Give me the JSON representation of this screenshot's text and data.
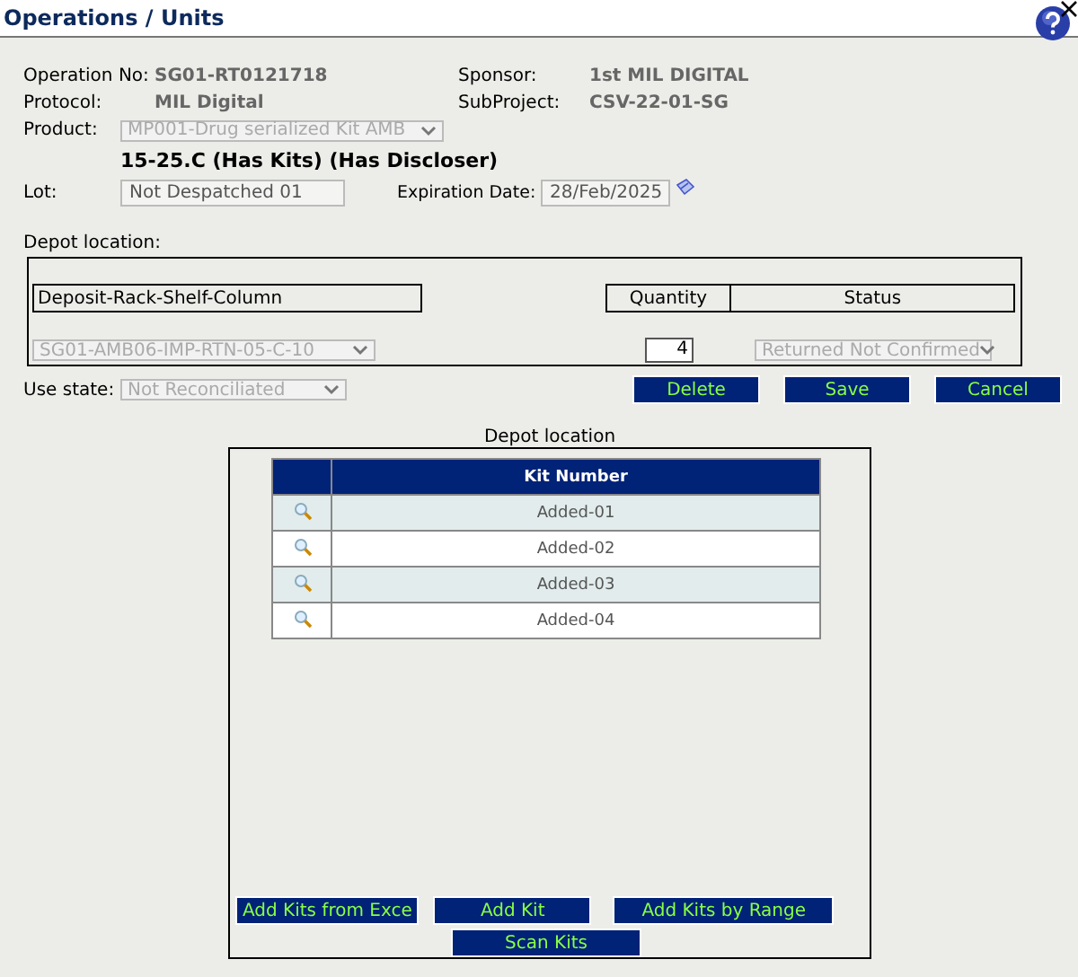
{
  "window": {
    "title": "Operations / Units"
  },
  "info": [
    {
      "label": "Operation No:",
      "value": "SG01-RT0121718"
    },
    {
      "label": "Sponsor:",
      "value": "1st MIL DIGITAL"
    },
    {
      "label": "Protocol:",
      "value": "MIL Digital"
    },
    {
      "label": "SubProject:",
      "value": "CSV-22-01-SG"
    }
  ],
  "product": {
    "label": "Product:",
    "value": "MP001-Drug serialized Kit AMB",
    "disabled": true
  },
  "product_tags": "15-25.C  (Has Kits)  (Has Discloser)",
  "lot": {
    "label": "Lot:",
    "value": "Not Despatched 01"
  },
  "expiration": {
    "label": "Expiration Date:",
    "value": "28/Feb/2025"
  },
  "depot": {
    "label": "Depot location:",
    "columns": [
      "Deposit-Rack-Shelf-Column",
      "Quantity",
      "Status"
    ],
    "location": {
      "value": "SG01-AMB06-IMP-RTN-05-C-10",
      "disabled": true
    },
    "quantity": "4",
    "status": {
      "value": "Returned Not Confirmed",
      "disabled": true
    }
  },
  "use_state": {
    "label": "Use state:",
    "value": "Not Reconciliated",
    "disabled": true
  },
  "actions": [
    "Delete",
    "Save",
    "Cancel"
  ],
  "kits": {
    "title": "Depot location",
    "column": "Kit Number",
    "rows": [
      {
        "kit": "Added-01"
      },
      {
        "kit": "Added-02"
      },
      {
        "kit": "Added-03"
      },
      {
        "kit": "Added-04"
      }
    ]
  },
  "kit_buttons": [
    "Add Kits from Exce",
    "Add Kit",
    "Add Kits by Range",
    "Scan Kits"
  ]
}
